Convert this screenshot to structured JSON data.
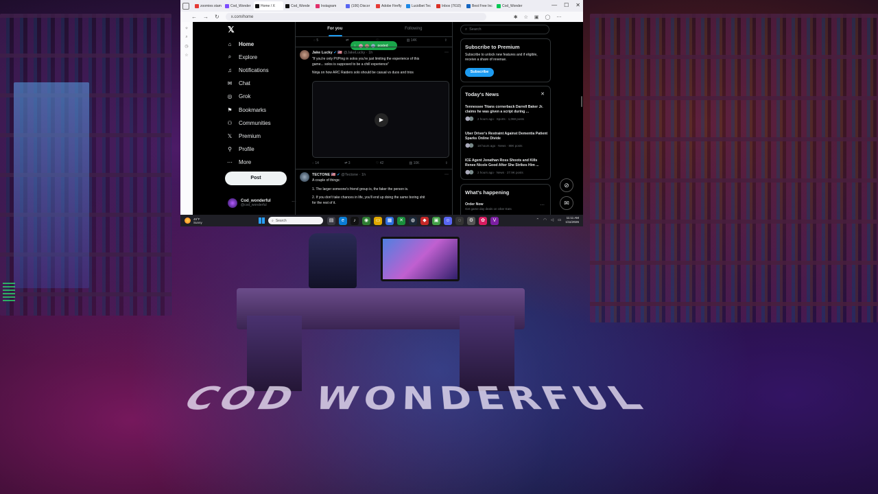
{
  "browser": {
    "tabs": [
      {
        "label": "zoomies stam",
        "color": "#e53935"
      },
      {
        "label": "Cod_Wonder",
        "color": "#7c4dff"
      },
      {
        "label": "Home / X",
        "color": "#111111",
        "active": true
      },
      {
        "label": "Cod_Wonde",
        "color": "#111111"
      },
      {
        "label": "Instagram",
        "color": "#e1306c"
      },
      {
        "label": "(106) Discor",
        "color": "#5865f2"
      },
      {
        "label": "Adobe Firefly",
        "color": "#e53935"
      },
      {
        "label": "Lucidbet Tec",
        "color": "#1e88e5"
      },
      {
        "label": "Inbox (7610)",
        "color": "#d93025"
      },
      {
        "label": "Best Free Inc",
        "color": "#1565c0"
      },
      {
        "label": "Cod_Wonder",
        "color": "#00c853"
      }
    ],
    "url": "x.com/home",
    "window_controls": [
      "—",
      "☐",
      "✕"
    ]
  },
  "nav": {
    "items": [
      {
        "label": "Home",
        "icon": "home-icon",
        "glyph": "⌂",
        "active": true
      },
      {
        "label": "Explore",
        "icon": "search-icon",
        "glyph": "⌕"
      },
      {
        "label": "Notifications",
        "icon": "bell-icon",
        "glyph": "♫"
      },
      {
        "label": "Chat",
        "icon": "mail-icon",
        "glyph": "✉"
      },
      {
        "label": "Grok",
        "icon": "grok-icon",
        "glyph": "◎"
      },
      {
        "label": "Bookmarks",
        "icon": "bookmark-icon",
        "glyph": "⚑"
      },
      {
        "label": "Communities",
        "icon": "communities-icon",
        "glyph": "⚇"
      },
      {
        "label": "Premium",
        "icon": "x-icon",
        "glyph": "𝕏"
      },
      {
        "label": "Profile",
        "icon": "profile-icon",
        "glyph": "⚲"
      },
      {
        "label": "More",
        "icon": "more-icon",
        "glyph": "⋯"
      }
    ],
    "post_label": "Post",
    "account": {
      "name": "Cod_wonderful",
      "handle": "@cod_wonderful"
    }
  },
  "timeline": {
    "tabs": [
      "For you",
      "Following"
    ],
    "top_actions": {
      "replies": "5",
      "reposts": "",
      "likes": "",
      "views": "14K"
    },
    "posted_pill": "posted",
    "tweets": [
      {
        "name": "Jake Lucky",
        "flag": "🇺🇸",
        "handle": "@JakeLucky",
        "time": "1h",
        "text_lines": [
          "\"If you're only PVPing in solos you're just limiting the experience of this",
          "game... solos is supposed to be a chill experience\"",
          "",
          "Ninja on how ARC Raiders solo should be casual vs duos and trios"
        ],
        "stats": {
          "replies": "14",
          "reposts": "3",
          "likes": "42",
          "views": "10K"
        }
      },
      {
        "name": "TECTONE",
        "flag": "🇺🇸",
        "handle": "@Tectone",
        "time": "1h",
        "text_lines": [
          "A couple of things:",
          "",
          "1. The larger someone's friend group is, the faker the person is.",
          "",
          "2. If you don't take chances in life, you'll end up doing the same boring shit",
          "for the rest of it."
        ]
      }
    ]
  },
  "right": {
    "search_placeholder": "Search",
    "premium": {
      "title": "Subscribe to Premium",
      "body": "Subscribe to unlock new features and if eligible, receive a share of revenue.",
      "button": "Subscribe"
    },
    "news": {
      "title": "Today's News",
      "items": [
        {
          "headline": "Tennessee Titans cornerback Darrell Baker Jr. claims he was given a script during ...",
          "meta": "2 hours ago · Sports · 1,068 posts"
        },
        {
          "headline": "Uber Driver's Restraint Against Dementia Patient Sparks Online Divide",
          "meta": "18 hours ago · News · 88K posts"
        },
        {
          "headline": "ICE Agent Jonathan Ross Shoots and Kills Renee Nicole Good After She Strikes Him ...",
          "meta": "2 hours ago · News · 27.9K posts"
        }
      ]
    },
    "happening": {
      "title": "What's happening",
      "item_title": "Order Now",
      "item_sub": "Get game day deals on Uber Eats"
    }
  },
  "taskbar": {
    "weather": {
      "temp": "49°F",
      "desc": "Sunny"
    },
    "search_placeholder": "Search",
    "apps": [
      {
        "icon": "files-icon",
        "glyph": "▤",
        "color": "#3a3a44"
      },
      {
        "icon": "edge-icon",
        "glyph": "e",
        "color": "#0b7dd6"
      },
      {
        "icon": "tiktok-icon",
        "glyph": "♪",
        "color": "#111111"
      },
      {
        "icon": "chrome-icon",
        "glyph": "◉",
        "color": "#2e7d32"
      },
      {
        "icon": "folder-icon",
        "glyph": "▭",
        "color": "#e0a800"
      },
      {
        "icon": "store-icon",
        "glyph": "▦",
        "color": "#2f6fe0"
      },
      {
        "icon": "xbox-icon",
        "glyph": "✕",
        "color": "#1a8f3c"
      },
      {
        "icon": "steam-icon",
        "glyph": "◍",
        "color": "#1b2838"
      },
      {
        "icon": "app-red-icon",
        "glyph": "◆",
        "color": "#c62828"
      },
      {
        "icon": "app-green-icon",
        "glyph": "▣",
        "color": "#43a047"
      },
      {
        "icon": "discord-icon",
        "glyph": "☺",
        "color": "#5865f2"
      },
      {
        "icon": "obs-icon",
        "glyph": "◌",
        "color": "#333333"
      },
      {
        "icon": "settings-icon",
        "glyph": "⚙",
        "color": "#555555"
      },
      {
        "icon": "app-pink-icon",
        "glyph": "✿",
        "color": "#d81b60"
      },
      {
        "icon": "app-purple-icon",
        "glyph": "V",
        "color": "#7b1fa2"
      }
    ],
    "time": "11:11 AM",
    "date": "1/11/2026"
  },
  "wallpaper": {
    "text": "COD WONDERFUL"
  },
  "colors": {
    "accent": "#1d9bf0",
    "posted_pill": "#1aa64a",
    "bg": "#000000"
  }
}
